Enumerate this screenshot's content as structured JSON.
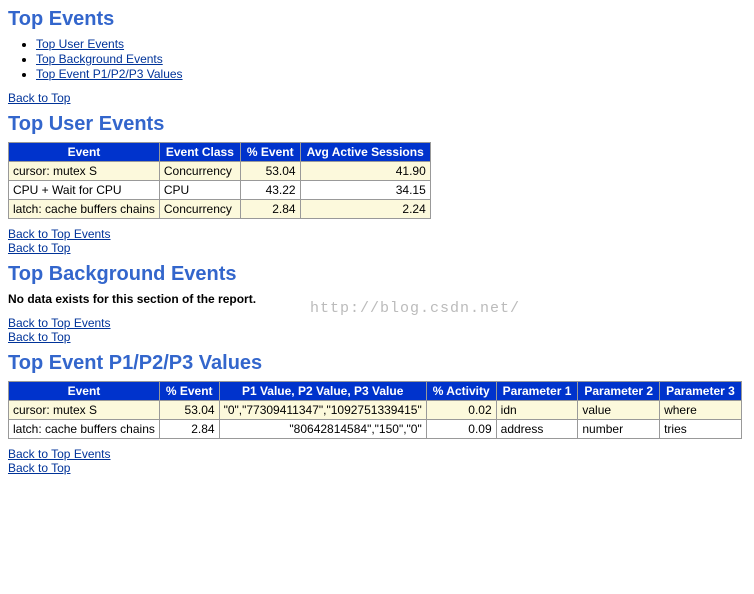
{
  "headings": {
    "top_events": "Top Events",
    "top_user_events": "Top User Events",
    "top_background_events": "Top Background Events",
    "top_event_p1p2p3": "Top Event P1/P2/P3 Values"
  },
  "links": {
    "top_user_events": "Top User Events",
    "top_background_events": "Top Background Events",
    "top_event_p1p2p3": "Top Event P1/P2/P3 Values",
    "back_to_top": "Back to Top",
    "back_to_top_events": "Back to Top Events"
  },
  "messages": {
    "no_data": "No data exists for this section of the report."
  },
  "watermark": "http://blog.csdn.net/",
  "chart_data": [
    {
      "type": "table",
      "title": "Top User Events",
      "columns": [
        "Event",
        "Event Class",
        "% Event",
        "Avg Active Sessions"
      ],
      "rows": [
        {
          "event": "cursor: mutex S",
          "event_class": "Concurrency",
          "pct_event": "53.04",
          "avg_active_sessions": "41.90"
        },
        {
          "event": "CPU + Wait for CPU",
          "event_class": "CPU",
          "pct_event": "43.22",
          "avg_active_sessions": "34.15"
        },
        {
          "event": "latch: cache buffers chains",
          "event_class": "Concurrency",
          "pct_event": "2.84",
          "avg_active_sessions": "2.24"
        }
      ]
    },
    {
      "type": "table",
      "title": "Top Event P1/P2/P3 Values",
      "columns": [
        "Event",
        "% Event",
        "P1 Value, P2 Value, P3 Value",
        "% Activity",
        "Parameter 1",
        "Parameter 2",
        "Parameter 3"
      ],
      "rows": [
        {
          "event": "cursor: mutex S",
          "pct_event": "53.04",
          "p1p2p3": "\"0\",\"77309411347\",\"1092751339415\"",
          "pct_activity": "0.02",
          "param1": "idn",
          "param2": "value",
          "param3": "where"
        },
        {
          "event": "latch: cache buffers chains",
          "pct_event": "2.84",
          "p1p2p3": "\"80642814584\",\"150\",\"0\"",
          "pct_activity": "0.09",
          "param1": "address",
          "param2": "number",
          "param3": "tries"
        }
      ]
    }
  ]
}
